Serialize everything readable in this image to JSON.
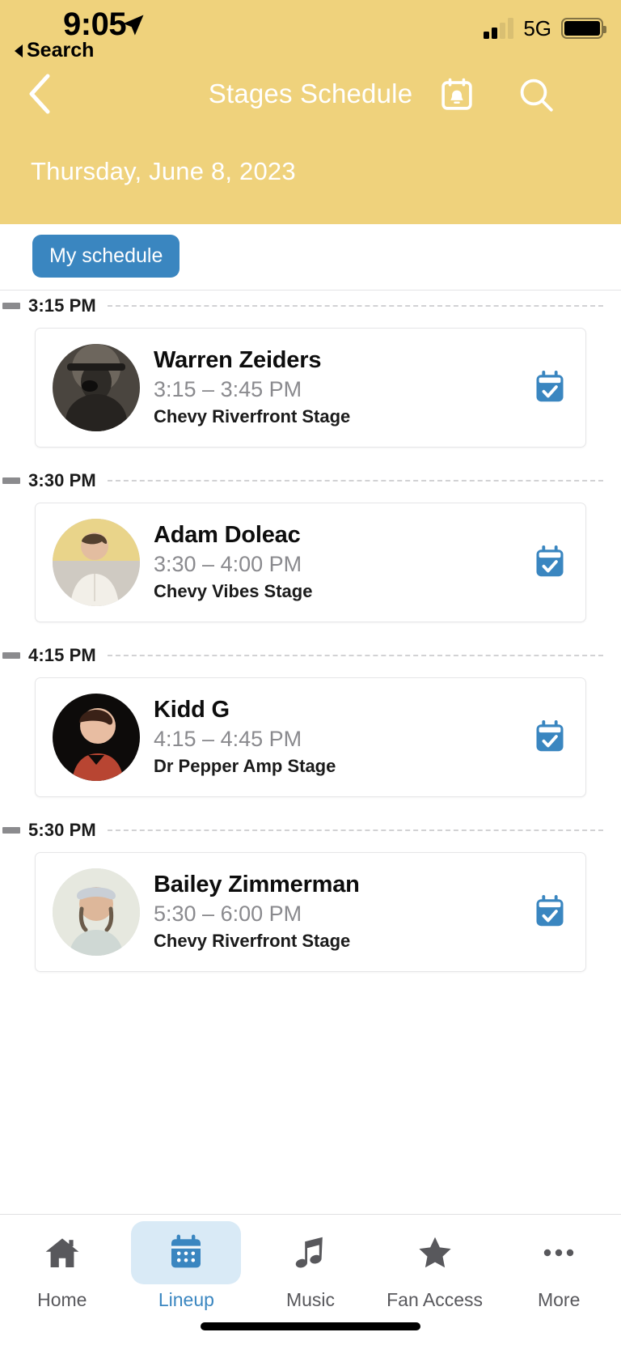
{
  "status_bar": {
    "time": "9:05",
    "back_app_label": "Search",
    "network": "5G",
    "location_icon": "location-arrow-icon",
    "signal_icon": "cellular-signal-icon",
    "battery_icon": "battery-full-icon"
  },
  "header": {
    "title": "Stages Schedule",
    "date": "Thursday, June 8, 2023",
    "background_color": "#efd27c",
    "back_icon": "chevron-left-icon",
    "alerts_icon": "calendar-bell-icon",
    "search_icon": "search-icon"
  },
  "filter_bar": {
    "my_schedule_label": "My schedule",
    "accent_color": "#3a86c0"
  },
  "schedule": {
    "groups": [
      {
        "time_label": "3:15 PM",
        "events": [
          {
            "artist": "Warren Zeiders",
            "time_range": "3:15 – 3:45 PM",
            "stage": "Chevy Riverfront Stage",
            "saved": true,
            "save_icon": "calendar-check-icon",
            "avatar_icon": "artist-avatar"
          }
        ]
      },
      {
        "time_label": "3:30 PM",
        "events": [
          {
            "artist": "Adam Doleac",
            "time_range": "3:30 – 4:00 PM",
            "stage": "Chevy Vibes Stage",
            "saved": true,
            "save_icon": "calendar-check-icon",
            "avatar_icon": "artist-avatar"
          }
        ]
      },
      {
        "time_label": "4:15 PM",
        "events": [
          {
            "artist": "Kidd G",
            "time_range": "4:15 – 4:45 PM",
            "stage": "Dr Pepper Amp Stage",
            "saved": true,
            "save_icon": "calendar-check-icon",
            "avatar_icon": "artist-avatar"
          }
        ]
      },
      {
        "time_label": "5:30 PM",
        "events": [
          {
            "artist": "Bailey Zimmerman",
            "time_range": "5:30 – 6:00 PM",
            "stage": "Chevy Riverfront Stage",
            "saved": true,
            "save_icon": "calendar-check-icon",
            "avatar_icon": "artist-avatar"
          }
        ]
      }
    ]
  },
  "tab_bar": {
    "active_index": 1,
    "active_color": "#3a86c0",
    "inactive_color": "#58585c",
    "items": [
      {
        "label": "Home",
        "icon": "home-icon"
      },
      {
        "label": "Lineup",
        "icon": "calendar-icon"
      },
      {
        "label": "Music",
        "icon": "music-note-icon"
      },
      {
        "label": "Fan Access",
        "icon": "star-icon"
      },
      {
        "label": "More",
        "icon": "ellipsis-icon"
      }
    ]
  }
}
